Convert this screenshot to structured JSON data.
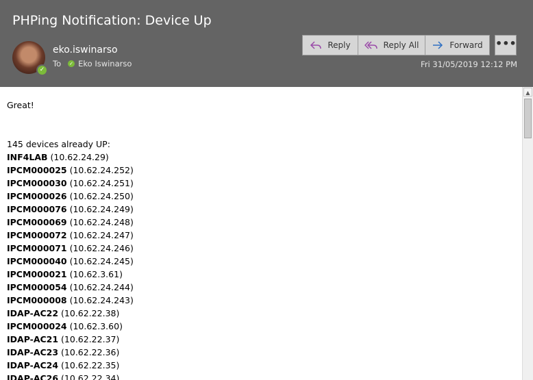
{
  "header": {
    "subject": "PHPing Notification: Device Up",
    "sender_name": "eko.iswinarso",
    "to_label": "To",
    "recipient": "Eko Iswinarso",
    "date": "Fri 31/05/2019 12:12 PM",
    "reply_label": "Reply",
    "reply_all_label": "Reply All",
    "forward_label": "Forward",
    "more_label": "•••"
  },
  "body": {
    "greeting": "Great!",
    "summary": "145 devices already UP:",
    "devices": [
      {
        "name": "INF4LAB",
        "ip": " (10.62.24.29)"
      },
      {
        "name": "IPCM000025",
        "ip": " (10.62.24.252)"
      },
      {
        "name": "IPCM000030",
        "ip": " (10.62.24.251)"
      },
      {
        "name": "IPCM000026",
        "ip": " (10.62.24.250)"
      },
      {
        "name": "IPCM000076",
        "ip": " (10.62.24.249)"
      },
      {
        "name": "IPCM000069",
        "ip": " (10.62.24.248)"
      },
      {
        "name": "IPCM000072",
        "ip": " (10.62.24.247)"
      },
      {
        "name": "IPCM000071",
        "ip": " (10.62.24.246)"
      },
      {
        "name": "IPCM000040",
        "ip": " (10.62.24.245)"
      },
      {
        "name": "IPCM000021",
        "ip": " (10.62.3.61)"
      },
      {
        "name": "IPCM000054",
        "ip": " (10.62.24.244)"
      },
      {
        "name": "IPCM000008",
        "ip": " (10.62.24.243)"
      },
      {
        "name": "IDAP-AC22",
        "ip": " (10.62.22.38)"
      },
      {
        "name": "IPCM000024",
        "ip": " (10.62.3.60)"
      },
      {
        "name": "IDAP-AC21",
        "ip": " (10.62.22.37)"
      },
      {
        "name": "IDAP-AC23",
        "ip": " (10.62.22.36)"
      },
      {
        "name": "IDAP-AC24",
        "ip": " (10.62.22.35)"
      },
      {
        "name": "IDAP-AC26",
        "ip": " (10.62.22.34)"
      }
    ]
  },
  "icons": {
    "presence": "✓",
    "scroll_up": "▲"
  },
  "colors": {
    "header_bg": "#646464",
    "presence_green": "#7cbb3a",
    "button_bg": "#d6d6d6",
    "reply_icon": "#9a4aa8",
    "forward_icon": "#2e6fc2"
  }
}
